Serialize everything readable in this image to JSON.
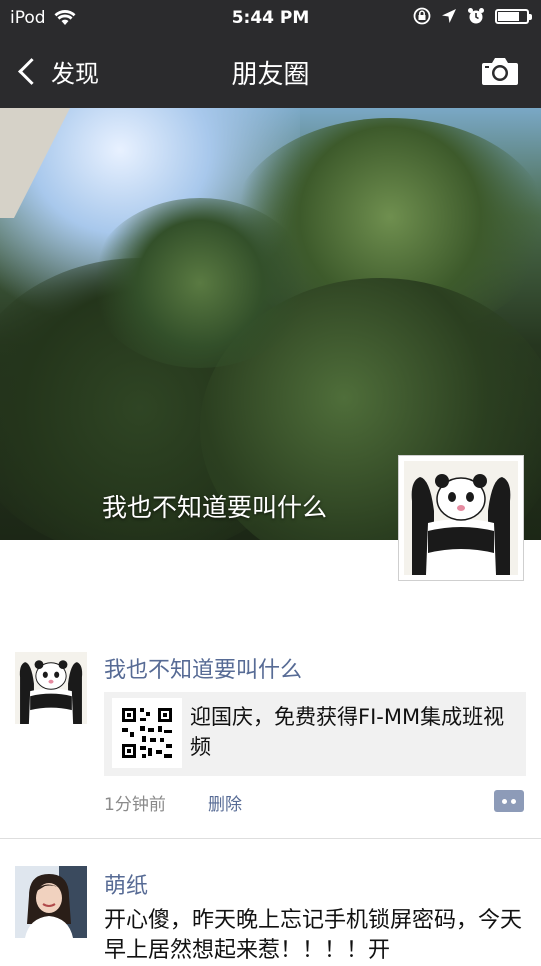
{
  "status_bar": {
    "device": "iPod",
    "time": "5:44 PM",
    "battery_level": 0.75,
    "icons": [
      "wifi-icon",
      "rotation-lock-icon",
      "location-icon",
      "alarm-icon",
      "battery-icon"
    ]
  },
  "nav": {
    "back_label": "发现",
    "title": "朋友圈",
    "right_icon": "camera-icon"
  },
  "cover": {
    "user_name": "我也不知道要叫什么",
    "avatar_icon": "panda-avatar"
  },
  "posts": [
    {
      "author": "我也不知道要叫什么",
      "avatar_icon": "panda-avatar",
      "link": {
        "thumbnail_icon": "qr-code-icon",
        "title": "迎国庆，免费获得FI-MM集成班视频"
      },
      "time": "1分钟前",
      "delete_label": "删除",
      "action_icon": "comment-icon"
    },
    {
      "author": "萌纸",
      "avatar_icon": "user-photo-avatar",
      "text": "开心傻，昨天晚上忘记手机锁屏密码，今天早上居然想起来惹！！！！开"
    }
  ],
  "colors": {
    "bar_background": "#2b2b2d",
    "name_link": "#576b95",
    "card_background": "#f1f1f1",
    "comment_button": "#8d9bb8"
  }
}
